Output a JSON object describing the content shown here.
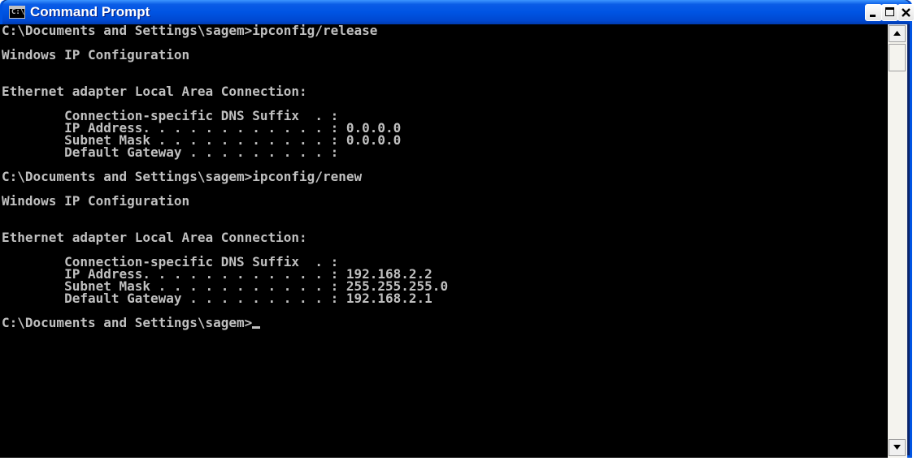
{
  "window": {
    "title": "Command Prompt",
    "icon": "console-icon",
    "icon_text": "C:\\"
  },
  "console": {
    "lines": [
      "C:\\Documents and Settings\\sagem>ipconfig/release",
      "",
      "Windows IP Configuration",
      "",
      "",
      "Ethernet adapter Local Area Connection:",
      "",
      "        Connection-specific DNS Suffix  . :",
      "        IP Address. . . . . . . . . . . . : 0.0.0.0",
      "        Subnet Mask . . . . . . . . . . . : 0.0.0.0",
      "        Default Gateway . . . . . . . . . :",
      "",
      "C:\\Documents and Settings\\sagem>ipconfig/renew",
      "",
      "Windows IP Configuration",
      "",
      "",
      "Ethernet adapter Local Area Connection:",
      "",
      "        Connection-specific DNS Suffix  . :",
      "        IP Address. . . . . . . . . . . . : 192.168.2.2",
      "        Subnet Mask . . . . . . . . . . . : 255.255.255.0",
      "        Default Gateway . . . . . . . . . : 192.168.2.1",
      ""
    ],
    "prompt": "C:\\Documents and Settings\\sagem>",
    "text_color": "#c0c0c0",
    "background_color": "#000000"
  },
  "colors": {
    "titlebar": "#0054e3",
    "close_button": "#e0e0e0"
  }
}
